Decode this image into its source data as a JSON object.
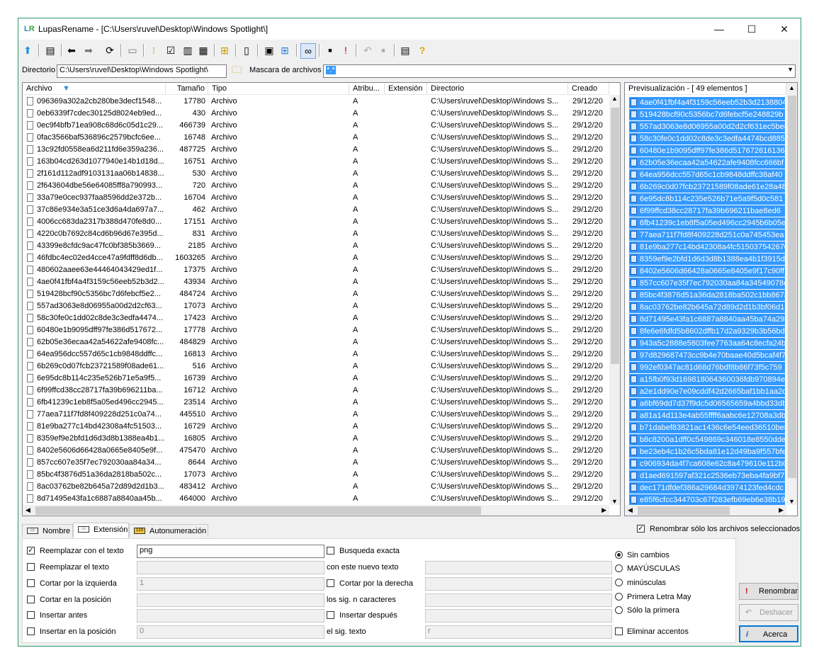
{
  "window": {
    "app_title": "LupasRename - [C:\\Users\\ruvel\\Desktop\\Windows Spotlight\\]",
    "logo": "LR",
    "min_label": "—",
    "max_label": "☐",
    "close_label": "✕"
  },
  "dirbar": {
    "directorio_label": "Directorio",
    "directorio_value": "C:\\Users\\ruvel\\Desktop\\Windows Spotlight\\",
    "mascara_label": "Mascara de archivos",
    "mascara_value": "*.*"
  },
  "filelist": {
    "columns": [
      "Archivo",
      "Tamaño",
      "Tipo",
      "Atribu...",
      "Extensión",
      "Directorio",
      "Creado"
    ],
    "tipo": "Archivo",
    "attr": "A",
    "dir": "C:\\Users\\ruvel\\Desktop\\Windows S...",
    "created": "29/12/20",
    "rows": [
      {
        "name": "096369a302a2cb280be3decf1548...",
        "size": "17780"
      },
      {
        "name": "0eb6339f7cdec30125d8024eb9ed...",
        "size": "430"
      },
      {
        "name": "0ec9f4bfb71ea908c68d6c05d1c29...",
        "size": "466739"
      },
      {
        "name": "0fac3566baf536896c2579bcfc6ee...",
        "size": "16748"
      },
      {
        "name": "13c92fd0558ea6d211fd6e359a236...",
        "size": "487725"
      },
      {
        "name": "163b04cd263d1077940e14b1d18d...",
        "size": "16751"
      },
      {
        "name": "2f161d112adf9103131aa06b14838...",
        "size": "530"
      },
      {
        "name": "2f643604dbe56e64085ff8a790993...",
        "size": "720"
      },
      {
        "name": "33a79e0cec937faa8596dd2e372b...",
        "size": "16704"
      },
      {
        "name": "37c86e934e3a51ce3d6a4da697a7...",
        "size": "462"
      },
      {
        "name": "4006cc683da2317b388d470fe8d0...",
        "size": "17151"
      },
      {
        "name": "4220c0b7692c84cd6b96d67e395d...",
        "size": "831"
      },
      {
        "name": "43399e8cfdc9ac47fc0bf385b3669...",
        "size": "2185"
      },
      {
        "name": "46fdbc4ec02ed4cce47a9fdff8d6db...",
        "size": "1603265"
      },
      {
        "name": "480602aaee63e44464043429ed1f...",
        "size": "17375"
      },
      {
        "name": "4ae0f41fbf4a4f3159c56eeb52b3d2...",
        "size": "43934"
      },
      {
        "name": "519428bcf90c5356bc7d6febcf5e2...",
        "size": "484724"
      },
      {
        "name": "557ad3063e8d06955a00d2d2cf63...",
        "size": "17073"
      },
      {
        "name": "58c30fe0c1dd02c8de3c3edfa4474...",
        "size": "17423"
      },
      {
        "name": "60480e1b9095dff97fe386d517672...",
        "size": "17778"
      },
      {
        "name": "62b05e36ecaa42a54622afe9408fc...",
        "size": "484829"
      },
      {
        "name": "64ea956dcc557d65c1cb9848ddffc...",
        "size": "16813"
      },
      {
        "name": "6b269c0d07fcb23721589f08ade61...",
        "size": "516"
      },
      {
        "name": "6e95dc8b114c235e526b71e5a9f5...",
        "size": "16739"
      },
      {
        "name": "6f99ffcd38cc28717fa39b696211ba...",
        "size": "16712"
      },
      {
        "name": "6fb41239c1eb8f5a05ed496cc2945...",
        "size": "23514"
      },
      {
        "name": "77aea711f7fd8f409228d251c0a74...",
        "size": "445510"
      },
      {
        "name": "81e9ba277c14bd42308a4fc51503...",
        "size": "16729"
      },
      {
        "name": "8359ef9e2bfd1d6d3d8b1388ea4b1...",
        "size": "16805"
      },
      {
        "name": "8402e5606d66428a0665e8405e9f...",
        "size": "475470"
      },
      {
        "name": "857cc607e35f7ec792030aa84a34...",
        "size": "8644"
      },
      {
        "name": "85bc4f3876d51a36da2818ba502c...",
        "size": "17073"
      },
      {
        "name": "8ac03762be82b645a72d89d2d1b3...",
        "size": "483412"
      },
      {
        "name": "8d71495e43fa1c6887a8840aa45b...",
        "size": "464000"
      }
    ]
  },
  "preview": {
    "header": "Previsualización - [ 49 elementos ]",
    "items": [
      "4ae0f41fbf4a4f3159c56eeb52b3d2138804",
      "519428bcf90c5356bc7d6febcf5e248829b",
      "557ad3063e8d06955a00d2d2cf631ec5be8",
      "58c30fe0c1dd02c8de3c3edfa4474bcd885",
      "60480e1b9095dff97fe386d517672616136",
      "62b05e36ecaa42a54622afe9408fcc666bf",
      "64ea956dcc557d65c1cb9848ddffc38af40",
      "6b269c0d07fcb23721589f08ade61e28a48",
      "6e95dc8b114c235e526b71e5a9f5d0c581",
      "6f99ffcd38cc28717fa39b696211bae8ed6",
      "6fb41239c1eb8f5a05ed496cc2945b6b05e",
      "77aea711f7fd8f409228d251c0a745453ea",
      "81e9ba277c14bd42308a4fc515037542670",
      "8359ef9e2bfd1d6d3d8b1388ea4b1f3915d",
      "8402e5606d66428a0665e8405e9f17c90ff",
      "857cc607e35f7ec792030aa84a34549078e",
      "85bc4f3876d51a36da2818ba502c1bb867a",
      "8ac03762be82b645a72d89d2d1b3bf06d1b",
      "8d71495e43fa1c6887a8840aa45ba74a29a",
      "8fe6e6fdfd5b8602dffb17d2a9329b3b56bd",
      "943a5c2888e5803fee7763aa64c8ecfa24b",
      "97d829687473cc9b4e70baae40d5bcaf4f7",
      "992ef0347ac81d68d76bdf8b86f73f5c759",
      "a15fb0f93d169818064360036fdb970894e",
      "a2e1dd90e7e09cddf42d2665baf1bb1aa2d",
      "a6bf69dd7d37f9dc5d06565659a4bbd33db",
      "a81a14d113e4ab55ffff6aabc6e12708a3db",
      "b71dabef83821ac1436c6e54eed36510be8",
      "b8c8200a1dff0c549869c346018e8550dde",
      "be23eb4c1b26c5bda81e12d49ba9f557bfe",
      "c906934da4f7ca608e62c8a479610e112b0",
      "d1aed691597af321c2536eb73eba4fa9bf7",
      "dec171dfdef386a29684d3974123fed4cdc",
      "e85f6cfcc344703c67f283efb69eb6e38b19"
    ]
  },
  "tabs": [
    "Nombre",
    "Extensión",
    "Autonumeración"
  ],
  "only_selected": "Renombrar sólo los archivos seleccionados",
  "options": {
    "reemplazar_texto": {
      "label": "Reemplazar con el texto",
      "value": "png"
    },
    "reemplazar_el": "Reemplazar el texto",
    "cortar_izq": {
      "label": "Cortar por la izquierda",
      "value": "1"
    },
    "cortar_pos": "Cortar en la posición",
    "insertar_antes": "Insertar antes",
    "insertar_pos": {
      "label": "Insertar en la posición",
      "value": "0"
    },
    "busqueda": "Busqueda exacta",
    "nuevo_texto": "con este nuevo texto",
    "cortar_der": "Cortar por la derecha",
    "sig_n": "los sig. n caracteres",
    "insertar_despues": "Insertar después",
    "sig_texto": {
      "label": "el sig. texto",
      "value": "r"
    }
  },
  "case": [
    "Sin cambios",
    "MAYÚSCULAS",
    "minúsculas",
    "Primera Letra May",
    "Sólo la primera"
  ],
  "eliminar_acentos": "Eliminar accentos",
  "buttons": {
    "renombrar": "Renombrar",
    "deshacer": "Deshacer",
    "acerca": "Acerca"
  }
}
